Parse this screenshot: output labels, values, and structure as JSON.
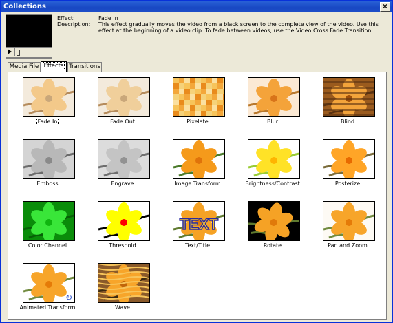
{
  "window": {
    "title": "Collections",
    "close_label": "×"
  },
  "info": {
    "effect_label": "Effect:",
    "effect_value": "Fade In",
    "description_label": "Description:",
    "description_value": "This effect gradually moves the video from a black screen to the complete view of the video. Use this effect at the beginning of a video clip. To fade between videos, use the Video Cross Fade Transition."
  },
  "tabs": [
    {
      "label": "Media File",
      "active": false
    },
    {
      "label": "Effects",
      "active": true
    },
    {
      "label": "Transitions",
      "active": false
    }
  ],
  "effects": [
    {
      "label": "Fade In",
      "selected": true
    },
    {
      "label": "Fade Out"
    },
    {
      "label": "Pixelate"
    },
    {
      "label": "Blur"
    },
    {
      "label": "Blind"
    },
    {
      "label": "Emboss"
    },
    {
      "label": "Engrave"
    },
    {
      "label": "Image Transform"
    },
    {
      "label": "Brightness/Contrast"
    },
    {
      "label": "Posterize"
    },
    {
      "label": "Color Channel"
    },
    {
      "label": "Threshold"
    },
    {
      "label": "Text/Title",
      "overlay_text": "TEXT"
    },
    {
      "label": "Rotate"
    },
    {
      "label": "Pan and Zoom"
    },
    {
      "label": "Animated Transform"
    },
    {
      "label": "Wave"
    }
  ],
  "colors": {
    "flower": "#f5a623",
    "petal_dark": "#e07b00",
    "bg": "#ffffff",
    "accent": "#0831d9"
  }
}
